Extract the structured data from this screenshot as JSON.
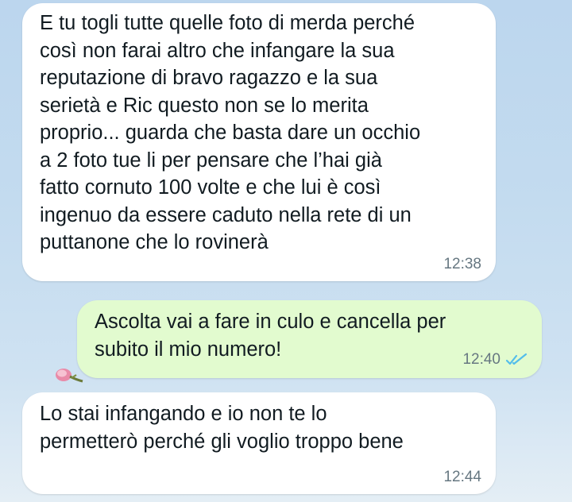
{
  "messages": [
    {
      "direction": "incoming",
      "lines": [
        "E tu togli tutte quelle foto di merda perché",
        "così non farai altro che infangare la sua",
        "reputazione di bravo ragazzo e la sua",
        "serietà e Ric questo non se lo merita",
        "proprio... guarda che basta dare un occhio",
        "a 2 foto tue li per pensare che l’hai già",
        "fatto cornuto 100 volte e che lui è così",
        "ingenuo da essere caduto nella rete di un",
        "puttanone che lo rovinerà"
      ],
      "time": "12:38"
    },
    {
      "direction": "outgoing",
      "lines": [
        "Ascolta vai a fare in culo e cancella per",
        "subito il mio numero!"
      ],
      "time": "12:40",
      "status": "read"
    },
    {
      "direction": "incoming",
      "lines": [
        "Lo stai infangando e io non te lo",
        "permetterò perché gli voglio troppo bene"
      ],
      "time": "12:44"
    }
  ],
  "colors": {
    "incoming_bubble": "#ffffff",
    "outgoing_bubble": "#e2fbcf",
    "read_ticks": "#53bdeb",
    "timestamp": "#667781"
  },
  "icons": {
    "read_receipt": "double-check-icon"
  }
}
